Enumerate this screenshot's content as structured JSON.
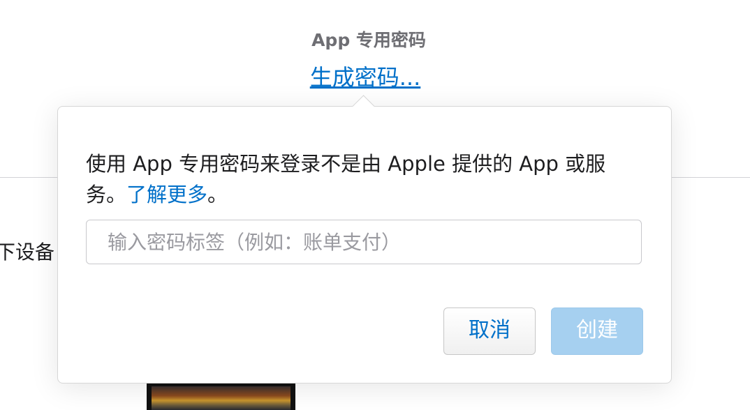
{
  "section": {
    "title": "App 专用密码",
    "generate_link": "生成密码..."
  },
  "background": {
    "devices_text": "下设备"
  },
  "popover": {
    "description": "使用 App 专用密码来登录不是由 Apple 提供的 App 或服务。",
    "learn_more": "了解更多",
    "description_end": "。",
    "input": {
      "placeholder": "输入密码标签（例如：账单支付）",
      "value": ""
    },
    "cancel_label": "取消",
    "create_label": "创建"
  },
  "colors": {
    "link": "#0070c9",
    "create_disabled": "#a6d0f0",
    "title_gray": "#6e6e73"
  }
}
